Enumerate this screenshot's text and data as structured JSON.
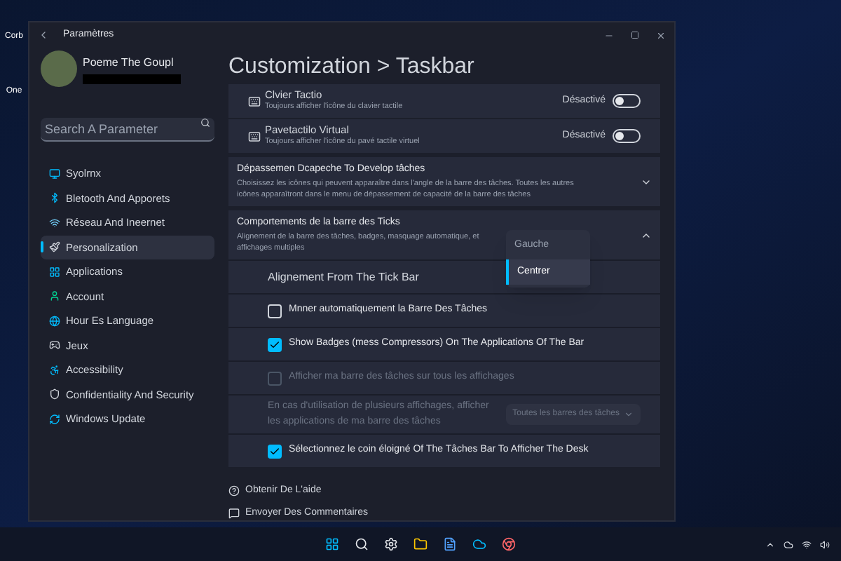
{
  "desktop_icons": [
    {
      "label": "Corb"
    },
    {
      "label": "One"
    }
  ],
  "window": {
    "title": "Paramètres"
  },
  "profile": {
    "name": "Poeme The Goupl"
  },
  "search": {
    "placeholder": "Search A Parameter"
  },
  "nav": [
    {
      "label": "Syolrnx",
      "selected": false
    },
    {
      "label": "Bletooth And Apporets",
      "selected": false
    },
    {
      "label": "Réseau And Ineernet",
      "selected": false
    },
    {
      "label": "Personalization",
      "selected": true
    },
    {
      "label": "Applications",
      "selected": false
    },
    {
      "label": "Account",
      "selected": false
    },
    {
      "label": "Hour Es Language",
      "selected": false
    },
    {
      "label": "Jeux",
      "selected": false
    },
    {
      "label": "Accessibility",
      "selected": false
    },
    {
      "label": "Confidentiality And Security",
      "selected": false
    },
    {
      "label": "Windows Update",
      "selected": false
    }
  ],
  "page_title": "Customization > Taskbar",
  "toggles": [
    {
      "title": "Clvier Tactio",
      "description": "Toujours afficher l'icône du clavier tactile",
      "state": "Désactivé",
      "on": false
    },
    {
      "title": "Pavetactilo Virtual",
      "description": "Toujours afficher l'icône du pavé tactile virtuel",
      "state": "Désactivé",
      "on": false
    }
  ],
  "sections": [
    {
      "title": "Dépassemen Dcapeche To Develop tâches",
      "description": "Choisissez les icônes qui peuvent apparaître dans l'angle de la barre des tâches. Toutes les autres icônes apparaîtront dans le menu de dépassement de capacité de la barre des tâches",
      "expanded": false
    },
    {
      "title": "Comportements de la barre des Ticks",
      "description": "Alignement de la barre des tâches, badges, masquage automatique, et affichages multiples",
      "expanded": true
    }
  ],
  "behavior_rows": [
    {
      "kind": "dropdown",
      "label": "Alignement From The Tick Bar",
      "options": [
        {
          "label": "Gauche",
          "selected": false
        },
        {
          "label": "Centrer",
          "selected": true
        }
      ]
    },
    {
      "kind": "checkbox",
      "label": "Mnner automatiquement la Barre Des Tâches",
      "checked": false,
      "disabled": false
    },
    {
      "kind": "checkbox",
      "label": "Show Badges (mess Compressors) On The Applications Of The Bar",
      "checked": true,
      "disabled": false
    },
    {
      "kind": "checkbox",
      "label": "Afficher ma barre des tâches sur tous les affichages",
      "checked": false,
      "disabled": true
    },
    {
      "kind": "select",
      "label": "En cas d'utilisation de plusieurs affichages, afficher les applications de ma barre des tâches",
      "value": "Toutes les barres des tâches",
      "disabled": true
    },
    {
      "kind": "checkbox",
      "label": "Sélectionnez le coin éloigné Of The Tâches Bar To Afficher The Desk",
      "checked": true,
      "disabled": false
    }
  ],
  "footer_links": [
    "Obtenir De L'aide",
    "Envoyer Des Commentaires"
  ]
}
